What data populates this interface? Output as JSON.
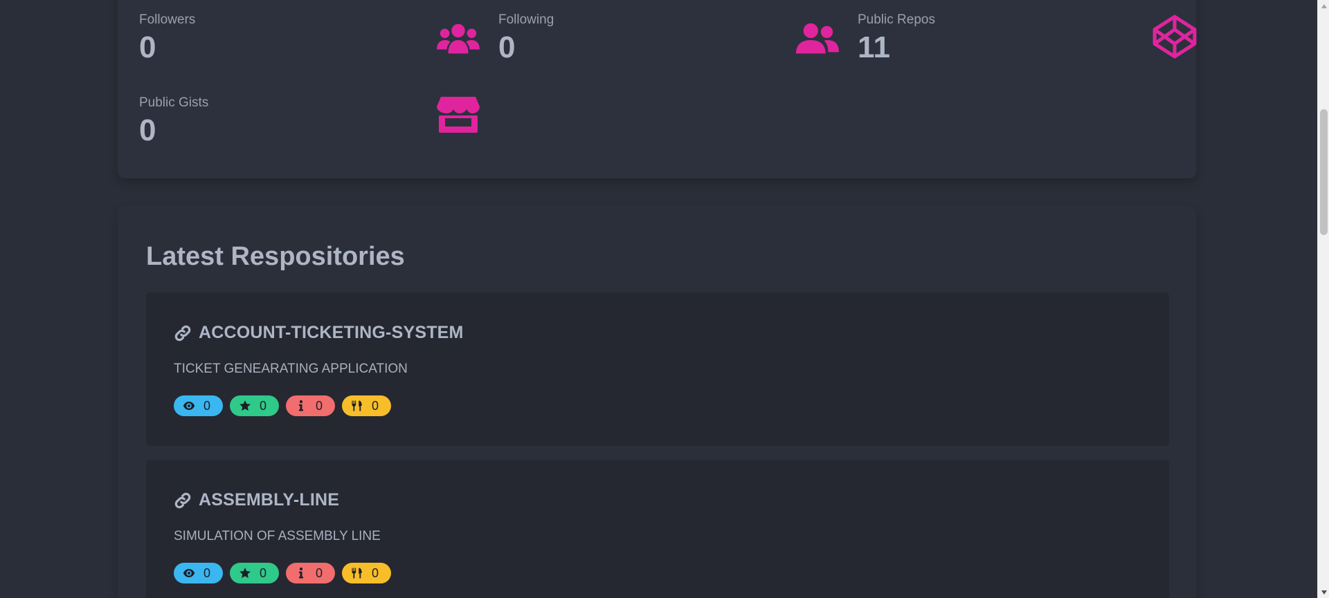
{
  "stats": {
    "followers": {
      "label": "Followers",
      "value": "0",
      "icon": "users-icon"
    },
    "following": {
      "label": "Following",
      "value": "0",
      "icon": "user-friends-icon"
    },
    "public_repos": {
      "label": "Public Repos",
      "value": "11",
      "icon": "codepen-cube-icon"
    },
    "public_gists": {
      "label": "Public Gists",
      "value": "0",
      "icon": "store-icon"
    }
  },
  "colors": {
    "accent": "#e0249e",
    "watch": "#3ab7f0",
    "star": "#2fc98a",
    "issue": "#f26d6d",
    "fork": "#f7be2a"
  },
  "repos_section": {
    "title": "Latest Respositories",
    "repos": [
      {
        "name": "ACCOUNT-TICKETING-SYSTEM",
        "description": "TICKET GENEARATING APPLICATION",
        "watchers": "0",
        "stars": "0",
        "issues": "0",
        "forks": "0"
      },
      {
        "name": "ASSEMBLY-LINE",
        "description": "SIMULATION OF ASSEMBLY LINE",
        "watchers": "0",
        "stars": "0",
        "issues": "0",
        "forks": "0"
      }
    ]
  }
}
